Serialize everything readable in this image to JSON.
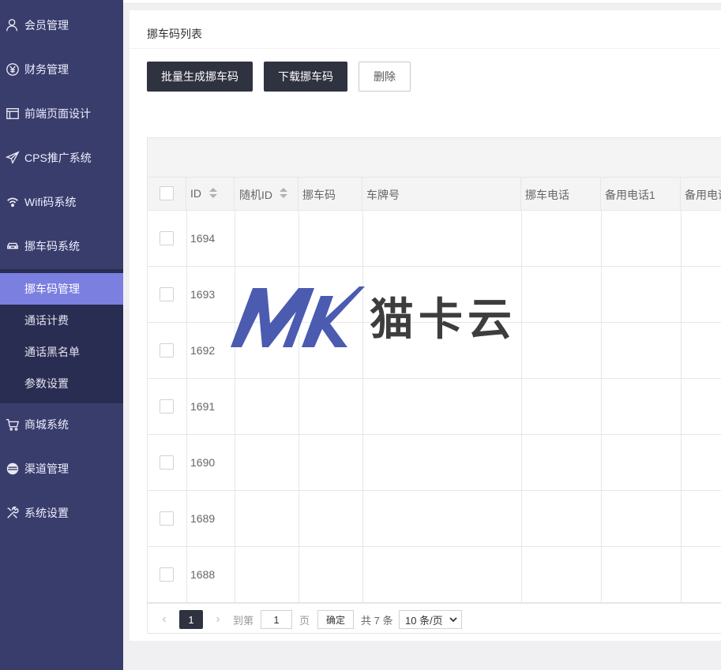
{
  "sidebar": {
    "items": [
      {
        "label": "会员管理",
        "icon": "user-icon"
      },
      {
        "label": "财务管理",
        "icon": "yen-icon"
      },
      {
        "label": "前端页面设计",
        "icon": "layout-icon"
      },
      {
        "label": "CPS推广系统",
        "icon": "paper-plane-icon"
      },
      {
        "label": "Wifi码系统",
        "icon": "wifi-icon"
      },
      {
        "label": "挪车码系统",
        "icon": "car-icon"
      },
      {
        "label": "商城系统",
        "icon": "cart-icon"
      },
      {
        "label": "渠道管理",
        "icon": "circle-lines-icon"
      },
      {
        "label": "系统设置",
        "icon": "tools-icon"
      }
    ],
    "subitems": [
      {
        "label": "挪车码管理",
        "active": true
      },
      {
        "label": "通话计费"
      },
      {
        "label": "通话黑名单"
      },
      {
        "label": "参数设置"
      }
    ]
  },
  "card": {
    "title": "挪车码列表",
    "buttons": {
      "batch_generate": "批量生成挪车码",
      "download": "下载挪车码",
      "delete": "删除"
    }
  },
  "table": {
    "columns": [
      "ID",
      "随机ID",
      "挪车码",
      "车牌号",
      "挪车电话",
      "备用电话1",
      "备用电话"
    ],
    "rows": [
      {
        "id": "1694"
      },
      {
        "id": "1693"
      },
      {
        "id": "1692"
      },
      {
        "id": "1691"
      },
      {
        "id": "1690"
      },
      {
        "id": "1689"
      },
      {
        "id": "1688"
      }
    ]
  },
  "pager": {
    "current_page": "1",
    "goto_label": "到第",
    "goto_value": "1",
    "page_unit": "页",
    "confirm": "确定",
    "total": "共 7 条",
    "per_page": "10 条/页"
  },
  "watermark": {
    "logo_text": "MK",
    "text": "猫卡云"
  }
}
